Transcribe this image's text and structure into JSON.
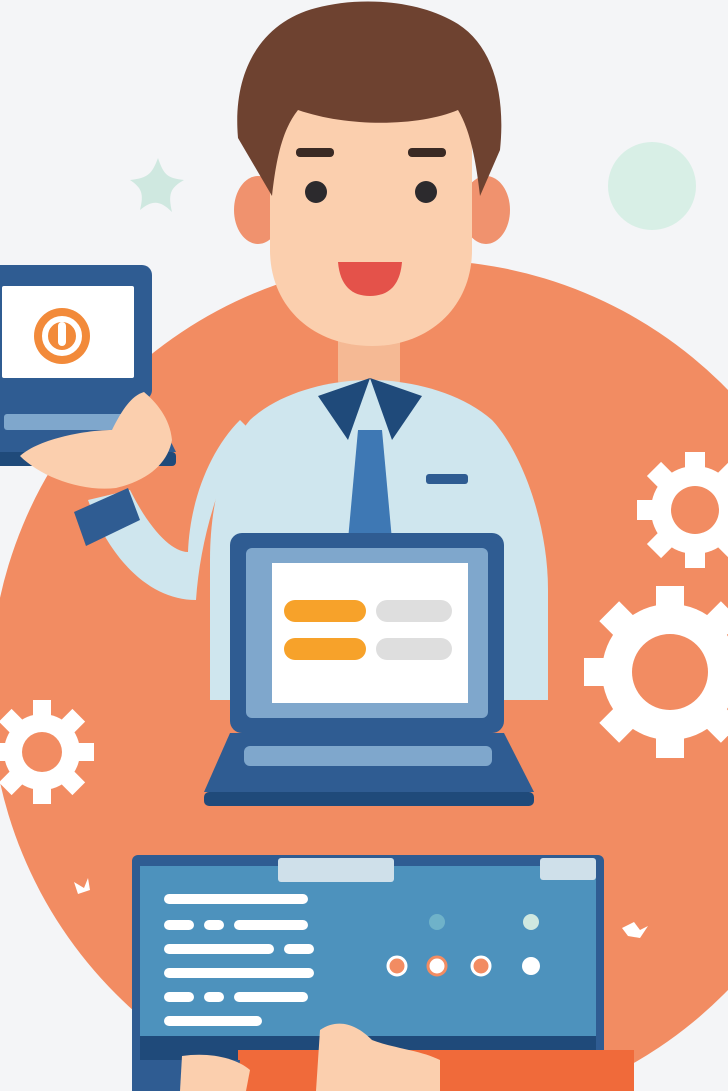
{
  "palette": {
    "background": "#f4f5f7",
    "circle": "#f28c62",
    "skin": "#fbcfae",
    "hair": "#6e4230",
    "shirt": "#cfe6ee",
    "collar": "#1f4a7a",
    "tie": "#3e78b4",
    "laptop_frame": "#2f5c92",
    "screen_blue": "#7fa7cc",
    "bottom_screen": "#4d92bd",
    "orange_bar": "#f7a22a",
    "gray_bar": "#dedede",
    "gear": "#ffffff",
    "mint": "#d8efe6",
    "mouth": "#e4524a"
  },
  "icons": [
    "at-sign-icon",
    "gear-icon",
    "star-sparkle-icon",
    "bird-icon"
  ]
}
